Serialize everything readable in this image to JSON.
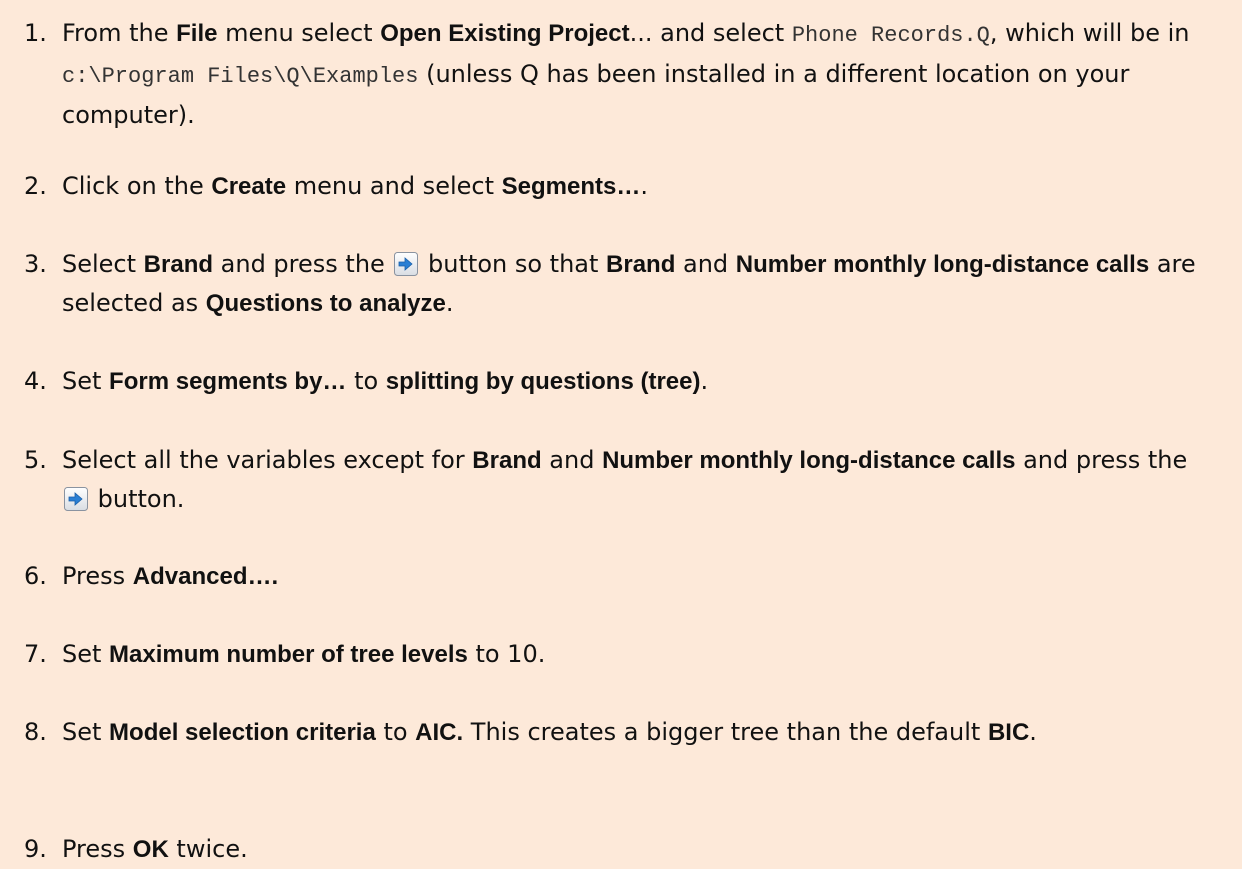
{
  "steps": [
    {
      "num": "1.",
      "t1": "From the ",
      "b1": "File",
      "t2": " menu select ",
      "b2": "Open Existing Project",
      "t3": "... and select ",
      "c1": "Phone Records.Q",
      "t4": ", which will be in ",
      "c2": "c:\\Program Files\\Q\\Examples",
      "t5": " (unless Q has been installed in a different location on your computer)."
    },
    {
      "num": "2.",
      "t1": "Click on the ",
      "b1": "Create",
      "t2": " menu and select ",
      "b2": "Segments…",
      "t3": "."
    },
    {
      "num": "3.",
      "t1": "Select ",
      "b1": "Brand",
      "t2": " and press the ",
      "icon": "right-arrow-button-icon",
      "t3": " button so that ",
      "b2": "Brand",
      "t4": " and ",
      "b3": "Number monthly long-distance calls",
      "t5": " are selected as ",
      "b4": "Questions to analyze",
      "t6": "."
    },
    {
      "num": "4.",
      "t1": "Set ",
      "b1": "Form segments by…",
      "t2": " to ",
      "b2": "splitting by questions (tree)",
      "t3": "."
    },
    {
      "num": "5.",
      "t1": "Select all the variables except for ",
      "b1": "Brand",
      "t2": " and ",
      "b2": "Number monthly long-distance calls",
      "t3": " and press the ",
      "icon": "right-arrow-button-icon",
      "t4": " button."
    },
    {
      "num": "6.",
      "t1": "Press ",
      "b1": "Advanced….",
      "t2": ""
    },
    {
      "num": "7.",
      "t1": "Set ",
      "b1": "Maximum number of tree levels",
      "t2": " to 10."
    },
    {
      "num": "8.",
      "t1": "Set ",
      "b1": "Model selection criteria",
      "t2": " to ",
      "b2": "AIC.",
      "t3": "  This creates a bigger tree than the default ",
      "b3": "BIC",
      "t4": "."
    },
    {
      "num": "9.",
      "t1": "Press ",
      "b1": "OK",
      "t2": " twice."
    }
  ],
  "colors": {
    "background": "#fde9d9",
    "text": "#111111",
    "icon_blue": "#2a7fd4"
  }
}
